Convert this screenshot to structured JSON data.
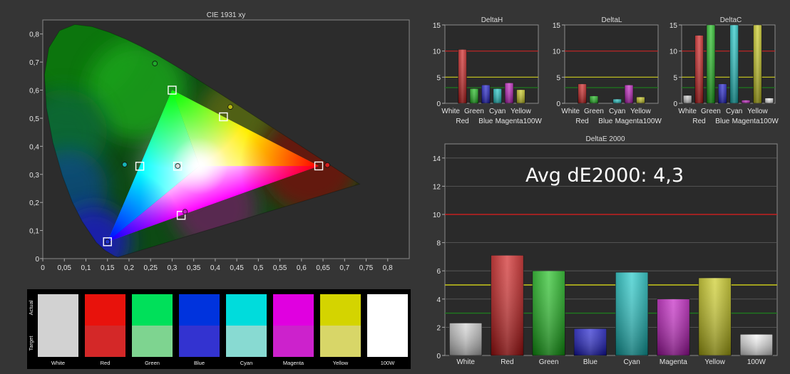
{
  "chart_data": [
    {
      "type": "scatter",
      "title": "CIE 1931 xy",
      "xlim": [
        0,
        0.85
      ],
      "ylim": [
        0,
        0.85
      ],
      "x_ticks": [
        "0",
        "0,05",
        "0,1",
        "0,15",
        "0,2",
        "0,25",
        "0,3",
        "0,35",
        "0,4",
        "0,45",
        "0,5",
        "0,55",
        "0,6",
        "0,65",
        "0,7",
        "0,75",
        "0,8"
      ],
      "y_ticks": [
        "0",
        "0,1",
        "0,2",
        "0,3",
        "0,4",
        "0,5",
        "0,6",
        "0,7",
        "0,8"
      ],
      "targets": [
        {
          "label": "Red",
          "x": 0.64,
          "y": 0.33
        },
        {
          "label": "Green",
          "x": 0.3,
          "y": 0.6
        },
        {
          "label": "Blue",
          "x": 0.15,
          "y": 0.06
        },
        {
          "label": "Cyan",
          "x": 0.225,
          "y": 0.329
        },
        {
          "label": "Magenta",
          "x": 0.321,
          "y": 0.154
        },
        {
          "label": "Yellow",
          "x": 0.419,
          "y": 0.505
        },
        {
          "label": "White",
          "x": 0.3127,
          "y": 0.329
        }
      ],
      "measured": [
        {
          "label": "Red",
          "x": 0.66,
          "y": 0.333,
          "color": "#d81e1e"
        },
        {
          "label": "Green",
          "x": 0.26,
          "y": 0.695,
          "color": "#1faa2a"
        },
        {
          "label": "Blue",
          "x": 0.15,
          "y": 0.06,
          "color": "#2233cc"
        },
        {
          "label": "Cyan",
          "x": 0.19,
          "y": 0.335,
          "color": "#17b3b3"
        },
        {
          "label": "Magenta",
          "x": 0.33,
          "y": 0.167,
          "color": "#c21ac2"
        },
        {
          "label": "Yellow",
          "x": 0.435,
          "y": 0.54,
          "color": "#b8b812"
        },
        {
          "label": "White",
          "x": 0.313,
          "y": 0.33,
          "color": "#dddddd"
        }
      ]
    },
    {
      "type": "bar",
      "title": "DeltaH",
      "ylim": [
        0,
        15
      ],
      "y_ticks": [
        "0",
        "5",
        "10",
        "15"
      ],
      "categories": [
        "White",
        "Red",
        "Green",
        "Blue",
        "Cyan",
        "Magenta",
        "Yellow",
        "100W"
      ],
      "values": [
        0,
        10.3,
        2.8,
        3.5,
        2.8,
        3.9,
        2.6,
        0
      ],
      "reference_lines": [
        10,
        5,
        3
      ]
    },
    {
      "type": "bar",
      "title": "DeltaL",
      "ylim": [
        0,
        15
      ],
      "y_ticks": [
        "0",
        "5",
        "10",
        "15"
      ],
      "categories": [
        "White",
        "Red",
        "Green",
        "Blue",
        "Cyan",
        "Magenta",
        "Yellow",
        "100W"
      ],
      "values": [
        0,
        3.7,
        1.4,
        0,
        0.8,
        3.5,
        1.2,
        0
      ],
      "reference_lines": [
        10,
        5,
        3
      ]
    },
    {
      "type": "bar",
      "title": "DeltaC",
      "ylim": [
        0,
        15
      ],
      "y_ticks": [
        "0",
        "5",
        "10",
        "15"
      ],
      "categories": [
        "White",
        "Red",
        "Green",
        "Blue",
        "Cyan",
        "Magenta",
        "Yellow",
        "100W"
      ],
      "values": [
        1.5,
        13,
        15,
        3.7,
        15,
        0.6,
        15,
        1
      ],
      "reference_lines": [
        10,
        5,
        3
      ]
    },
    {
      "type": "bar",
      "title": "DeltaE 2000",
      "annotation": "Avg dE2000: 4,3",
      "ylim": [
        0,
        15
      ],
      "y_ticks": [
        "0",
        "2",
        "4",
        "6",
        "8",
        "10",
        "12",
        "14"
      ],
      "categories": [
        "White",
        "Red",
        "Green",
        "Blue",
        "Cyan",
        "Magenta",
        "Yellow",
        "100W"
      ],
      "values": [
        2.3,
        7.1,
        6.0,
        1.9,
        5.9,
        4.0,
        5.5,
        1.5
      ],
      "reference_lines": [
        10,
        5,
        3
      ]
    },
    {
      "type": "table",
      "row_labels": [
        "Actual",
        "Target"
      ],
      "categories": [
        "White",
        "Red",
        "Green",
        "Blue",
        "Cyan",
        "Magenta",
        "Yellow",
        "100W"
      ],
      "actual_colors": [
        "#d2d2d2",
        "#e8120c",
        "#00e05a",
        "#0033dd",
        "#00dcdc",
        "#e000e0",
        "#d4d400",
        "#ffffff"
      ],
      "target_colors": [
        "#d2d2d2",
        "#d42828",
        "#7ed490",
        "#3333d0",
        "#88dad2",
        "#cc22cc",
        "#d8d668",
        "#ffffff"
      ]
    }
  ],
  "colors": {
    "background": "#353535",
    "plot_background": "#2a2a2a",
    "bar_colors": [
      "#d0d0d0",
      "#cc1111",
      "#11bb11",
      "#1111cc",
      "#11c4c4",
      "#c011c0",
      "#c8c811",
      "#f4f4f4"
    ],
    "ref_red": "#c42020",
    "ref_yellow": "#c8c81a",
    "ref_green": "#1e7a1e"
  }
}
